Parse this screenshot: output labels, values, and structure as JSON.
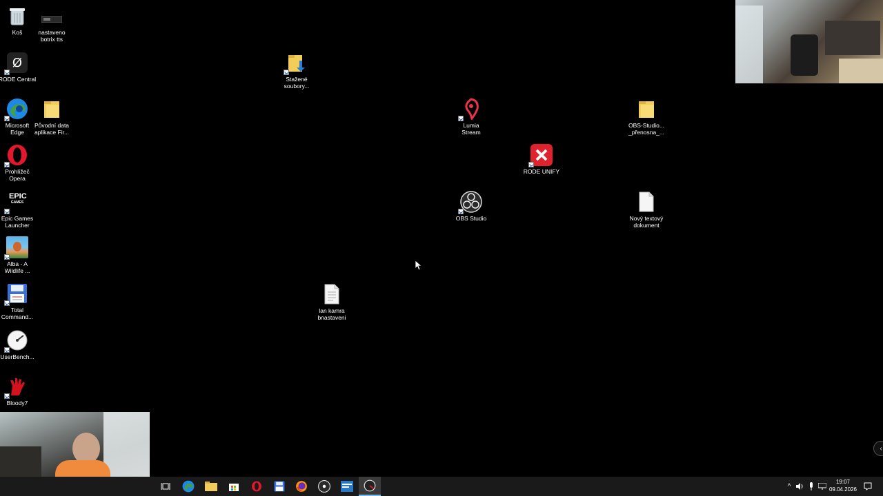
{
  "desktop": {
    "icons": {
      "recycle_bin": "Koš",
      "botrix": "nastaveno\nbotrix tts",
      "rode_central": "RODE Central",
      "edge": "Microsoft\nEdge",
      "original_data": "Původní data\naplikace Fir...",
      "opera": "Prohlížeč\nOpera",
      "epic": "Epic Games\nLauncher",
      "alba": "Alba - A\nWildlife ...",
      "total_commander": "Total\nCommand...",
      "userbench": "UserBench...",
      "bloody": "Bloody7",
      "downloads": "Stažené\nsoubory...",
      "lumia": "Lumia\nStream",
      "obs_folder": "OBS-Studio...\n_přenosna_...",
      "rode_unify": "RODE UNIFY",
      "obs_studio": "OBS Studio",
      "new_text": "Nový textový\ndokument",
      "lan_kamera": "lan kamra\nbnastaveni"
    }
  },
  "taskbar": {
    "clock_time": "19:07",
    "clock_date": "09.04.2026"
  },
  "colors": {
    "desktop_bg": "#000000",
    "taskbar_bg": "#1a1a1a",
    "active_accent": "#76b9ed"
  }
}
